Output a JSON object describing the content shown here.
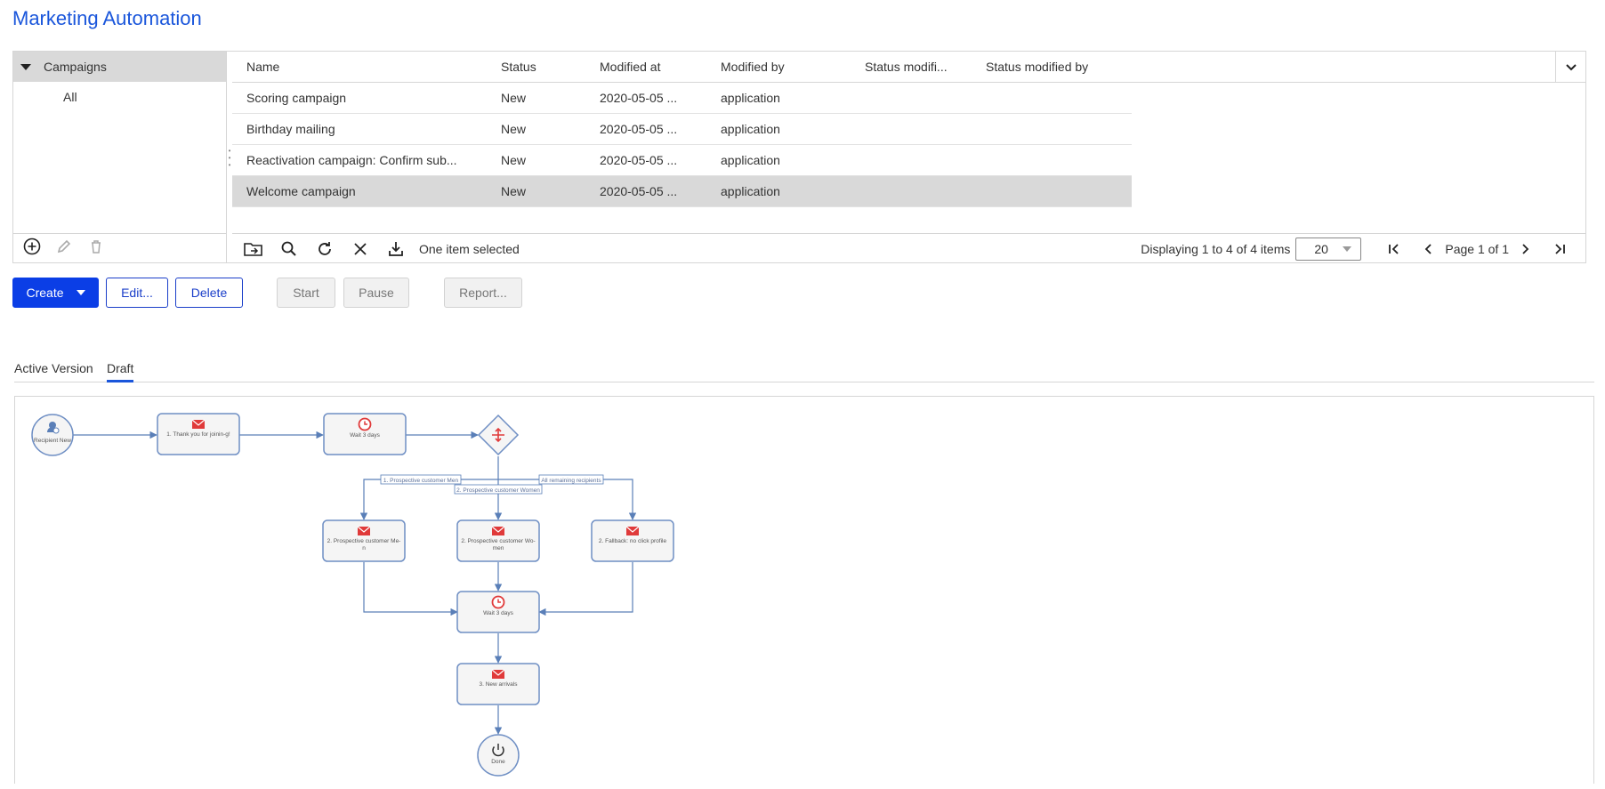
{
  "app": {
    "title": "Marketing Automation"
  },
  "tree": {
    "root_label": "Campaigns",
    "items": [
      {
        "label": "All"
      }
    ]
  },
  "grid": {
    "columns": [
      "Name",
      "Status",
      "Modified at",
      "Modified by",
      "Status modifi...",
      "Status modified by"
    ],
    "rows": [
      {
        "name": "Scoring campaign",
        "status": "New",
        "modified_at": "2020-05-05 ...",
        "modified_by": "application",
        "selected": false
      },
      {
        "name": "Birthday mailing",
        "status": "New",
        "modified_at": "2020-05-05 ...",
        "modified_by": "application",
        "selected": false
      },
      {
        "name": "Reactivation campaign: Confirm sub...",
        "status": "New",
        "modified_at": "2020-05-05 ...",
        "modified_by": "application",
        "selected": false
      },
      {
        "name": "Welcome campaign",
        "status": "New",
        "modified_at": "2020-05-05 ...",
        "modified_by": "application",
        "selected": true
      }
    ],
    "selection_text": "One item selected",
    "pager": {
      "display_text": "Displaying 1 to 4 of 4 items",
      "page_size": "20",
      "page_text": "Page 1 of 1"
    }
  },
  "actions": {
    "create": "Create",
    "edit": "Edit...",
    "delete": "Delete",
    "start": "Start",
    "pause": "Pause",
    "report": "Report..."
  },
  "tabs": {
    "active_version": "Active Version",
    "draft": "Draft",
    "selected": "draft"
  },
  "workflow": {
    "colors": {
      "line": "#5a7fb8",
      "icon": "#e03a3a",
      "node_border": "#6f8fc4",
      "node_fill": "#f5f5f5"
    },
    "nodes": {
      "start": "Recipient New",
      "email1": "1. Thank you for joinin-g!",
      "wait1": "Wait 3 days",
      "email_men": "2. Prospective customer Me-n",
      "email_women": "2. Prospective customer Wo-men",
      "email_fallback": "2. Fallback: no click profile",
      "wait2": "Wait 3 days",
      "email3": "3. New arrivals",
      "end": "Done"
    },
    "branches": {
      "men": "1. Prospective customer Men",
      "women": "2. Prospective customer Women",
      "remaining": "All remaining recipients"
    }
  }
}
